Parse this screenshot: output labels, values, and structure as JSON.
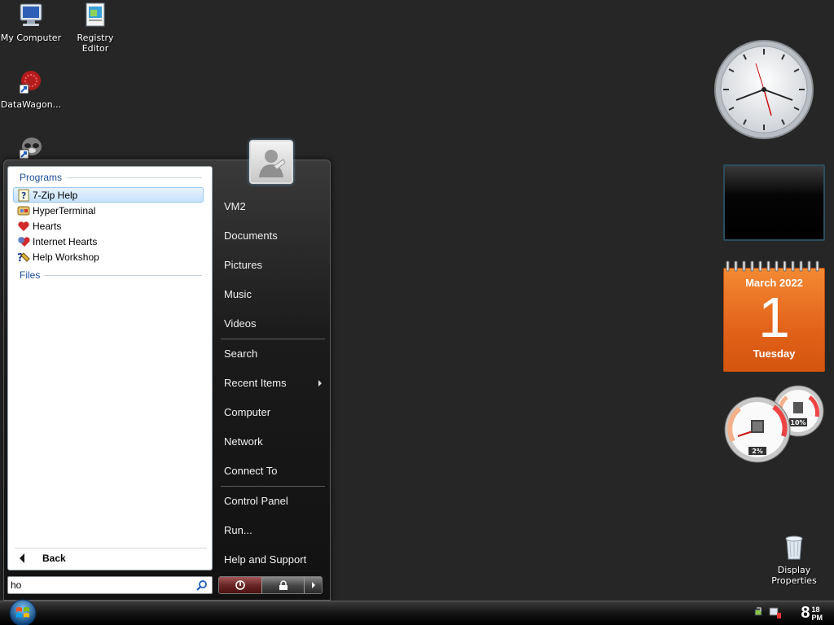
{
  "desktop": {
    "icons": [
      {
        "label": "My Computer",
        "icon": "my-computer-icon"
      },
      {
        "label": "Registry Editor",
        "icon": "registry-editor-icon"
      },
      {
        "label": "DataWagon...",
        "icon": "datawagon-icon"
      },
      {
        "label": "",
        "icon": "raccoon-shortcut-icon"
      },
      {
        "label": "Display Properties",
        "icon": "recycle-bin-icon"
      }
    ]
  },
  "start_menu": {
    "programs_header": "Programs",
    "files_header": "Files",
    "programs": [
      {
        "label": "7-Zip Help",
        "icon": "help-file-icon",
        "selected": true
      },
      {
        "label": "HyperTerminal",
        "icon": "hyperterminal-icon",
        "selected": false
      },
      {
        "label": "Hearts",
        "icon": "hearts-icon",
        "selected": false
      },
      {
        "label": "Internet Hearts",
        "icon": "internet-hearts-icon",
        "selected": false
      },
      {
        "label": "Help Workshop",
        "icon": "help-workshop-icon",
        "selected": false
      }
    ],
    "back_label": "Back",
    "search": {
      "value": "ho",
      "placeholder": ""
    },
    "right_items": [
      "VM2",
      "Documents",
      "Pictures",
      "Music",
      "Videos",
      "Search",
      "Recent Items",
      "Computer",
      "Network",
      "Connect To",
      "Control Panel",
      "Run...",
      "Help and Support"
    ]
  },
  "gadgets": {
    "calendar": {
      "month_year": "March 2022",
      "day": "1",
      "weekday": "Tuesday"
    },
    "cpu_meter": {
      "cpu": "2%",
      "memory": "10%"
    }
  },
  "taskbar": {
    "clock": {
      "hour": "8",
      "minute": "18",
      "ampm": "PM"
    }
  },
  "colors": {
    "desktop_bg": "#262626",
    "programs_header": "#1e4c9a",
    "calendar_orange": "#e2621a"
  }
}
